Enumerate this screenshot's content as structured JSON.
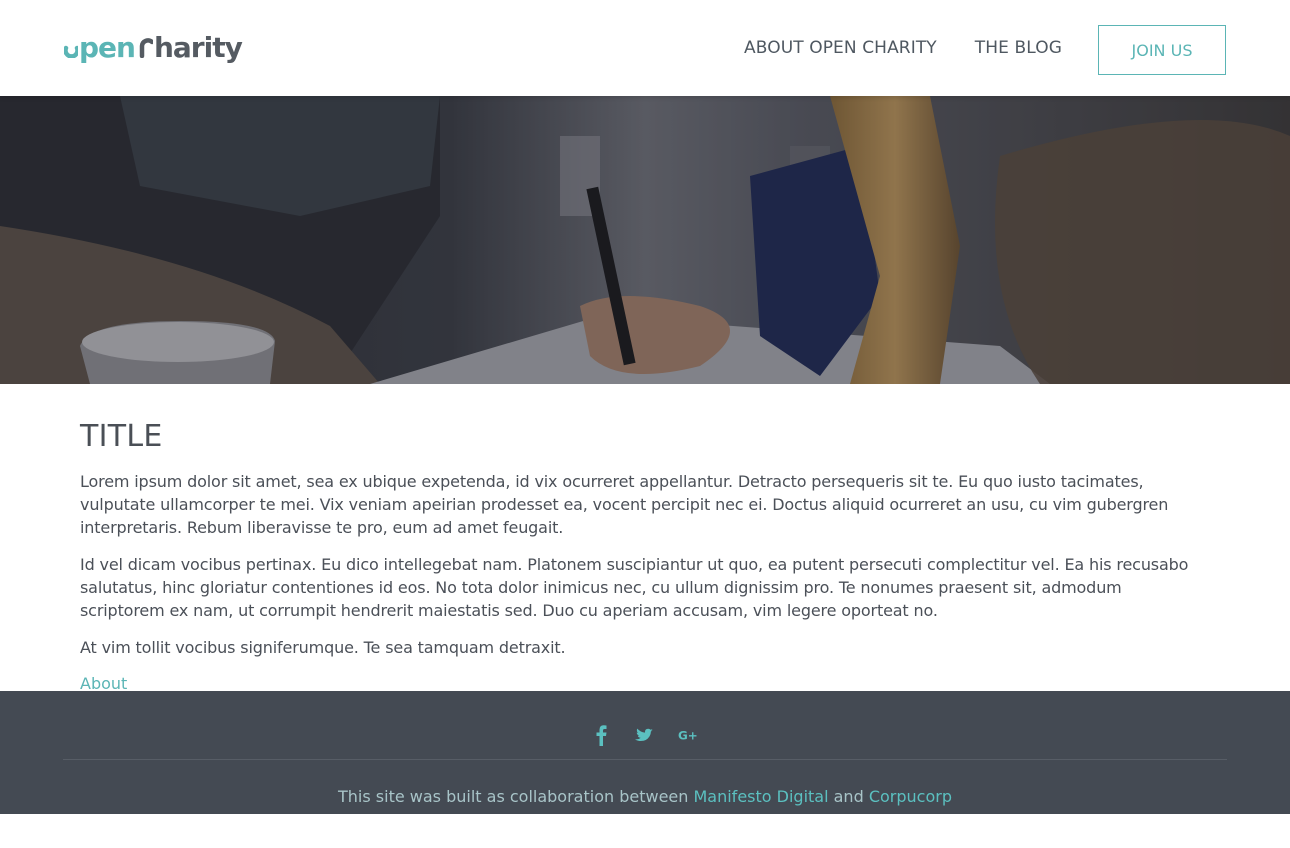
{
  "header": {
    "logo": {
      "part1": "pen",
      "part2": "harity"
    },
    "nav": [
      {
        "label": "ABOUT OPEN CHARITY"
      },
      {
        "label": "THE BLOG"
      }
    ],
    "cta_label": "JOIN US"
  },
  "hero": {
    "image": "people-writing-at-table-photo"
  },
  "main": {
    "title": "TITLE",
    "paragraphs": [
      "Lorem ipsum dolor sit amet, sea ex ubique expetenda, id vix ocurreret appellantur. Detracto persequeris sit te. Eu quo iusto tacimates, vulputate ullamcorper te mei. Vix veniam apeirian prodesset ea, vocent percipit nec ei. Doctus aliquid ocurreret an usu, cu vim gubergren interpretaris. Rebum liberavisse te pro, eum ad amet feugait.",
      "Id vel dicam vocibus pertinax. Eu dico intellegebat nam. Platonem suscipiantur ut quo, ea putent persecuti complectitur vel. Ea his recusabo salutatus, hinc gloriatur contentiones id eos. No tota dolor inimicus nec, cu ullum dignissim pro. Te nonumes praesent sit, admodum scriptorem ex nam, ut corrumpit hendrerit maiestatis sed. Duo cu aperiam accusam, vim legere oporteat no.",
      "At vim tollit vocibus signiferumque. Te sea tamquam detraxit."
    ],
    "link_label": "About"
  },
  "footer": {
    "social_icons": [
      "facebook-icon",
      "twitter-icon",
      "google-plus-icon"
    ],
    "credit_prefix": "This site was built as collaboration between ",
    "credit_link1": "Manifesto Digital",
    "credit_and": " and ",
    "credit_link2": "Corpucorp"
  },
  "colors": {
    "accent": "#5bb5b5",
    "text": "#4a4f56",
    "footer_bg": "#444a53",
    "footer_text": "#a8c4c8"
  }
}
